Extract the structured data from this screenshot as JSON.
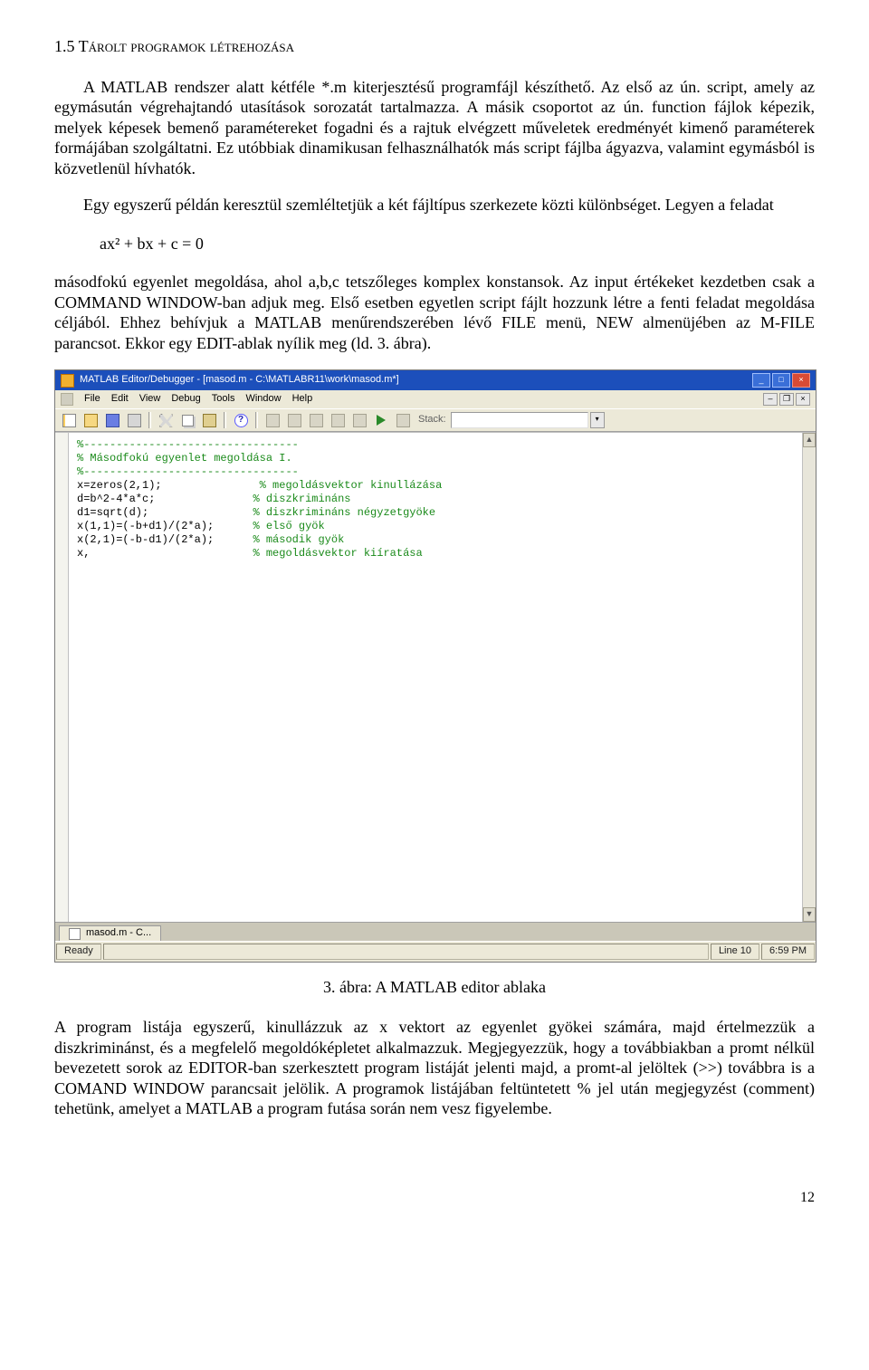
{
  "heading": "1.5  Tárolt programok létrehozása",
  "para1": "A MATLAB rendszer alatt kétféle *.m kiterjesztésű programfájl készíthető. Az első az ún. script, amely az egymásután végrehajtandó utasítások sorozatát tartalmazza. A másik csoportot az ún. function fájlok képezik, melyek képesek bemenő paramétereket fogadni és a rajtuk elvégzett műveletek eredményét kimenő paraméterek formájában szolgáltatni. Ez utóbbiak dinamikusan felhasználhatók más script fájlba ágyazva, valamint egymásból is közvetlenül hívhatók.",
  "para2": "Egy egyszerű példán keresztül szemléltetjük a két fájltípus szerkezete közti különbséget. Legyen a feladat",
  "formula": "ax² + bx + c = 0",
  "para3": "másodfokú egyenlet megoldása, ahol a,b,c tetszőleges komplex konstansok. Az input értékeket kezdetben csak a COMMAND WINDOW-ban adjuk meg. Első esetben egyetlen script fájlt hozzunk létre a fenti feladat megoldása céljából. Ehhez behívjuk a MATLAB menűrendszerében lévő FILE menü, NEW almenüjében az M-FILE parancsot. Ekkor egy EDIT-ablak nyílik meg (ld. 3. ábra).",
  "caption": "3. ábra: A MATLAB editor ablaka",
  "para4": "A program listája egyszerű, kinullázzuk az x vektort az egyenlet gyökei számára, majd értelmezzük a diszkriminánst, és a megfelelő megoldóképletet alkalmazzuk. Megjegyezzük, hogy a továbbiakban a promt nélkül bevezetett sorok az EDITOR-ban szerkesztett program listáját jelenti majd, a promt-al jelöltek (>>) továbbra is a COMAND WINDOW parancsait jelölik. A programok listájában feltüntetett % jel után megjegyzést (comment) tehetünk, amelyet a MATLAB a program futása során nem vesz figyelembe.",
  "pagenum": "12",
  "matlab": {
    "title": "MATLAB Editor/Debugger - [masod.m - C:\\MATLABR11\\work\\masod.m*]",
    "menus": {
      "file": "File",
      "edit": "Edit",
      "view": "View",
      "debug": "Debug",
      "tools": "Tools",
      "window": "Window",
      "help": "Help"
    },
    "stack_label": "Stack:",
    "tab_label": "masod.m - C...",
    "status_ready": "Ready",
    "status_line": "Line 10",
    "status_time": "6:59 PM",
    "help_glyph": "?",
    "win": {
      "min": "_",
      "max": "□",
      "close": "×",
      "dash": "–",
      "restore": "❐"
    },
    "code": {
      "l1": "%---------------------------------",
      "l2": "% Másodfokú egyenlet megoldása I.",
      "l3": "%---------------------------------",
      "l4a": "x=zeros(2,1);",
      "l4b": "% megoldásvektor kinullázása",
      "l5a": "d=b^2-4*a*c;",
      "l5b": "% diszkrimináns",
      "l6a": "d1=sqrt(d);",
      "l6b": "% diszkrimináns négyzetgyöke",
      "l7a": "x(1,1)=(-b+d1)/(2*a);",
      "l7b": "% első gyök",
      "l8a": "x(2,1)=(-b-d1)/(2*a);",
      "l8b": "% második gyök",
      "l9a": "x,",
      "l9b": "% megoldásvektor kiíratása"
    }
  }
}
